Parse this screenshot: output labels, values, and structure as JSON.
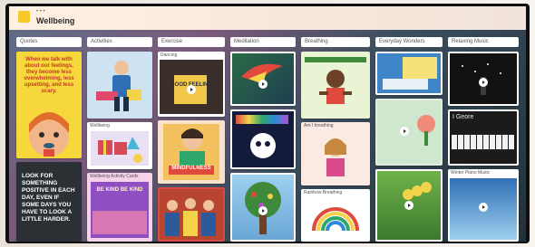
{
  "header": {
    "breadcrumb": "• • •",
    "title": "Wellbeing"
  },
  "columns": [
    {
      "label": "Quotes"
    },
    {
      "label": "Activities"
    },
    {
      "label": "Exercise"
    },
    {
      "label": "Meditation"
    },
    {
      "label": "Breathing"
    },
    {
      "label": "Everyday Wonders"
    },
    {
      "label": "Relaxing Music"
    }
  ],
  "cards": {
    "quote1_text": "When we talk with about our feelings, they become less overwhelming, less upsetting, and less scary.",
    "quote2_text": "LOOK FOR SOMETHING POSITIVE IN EACH DAY, EVEN IF SOME DAYS YOU HAVE TO LOOK A LITTLE HARDER.",
    "exercise1_title": "Dancing",
    "exercise1_art": "GOOD FEELING",
    "exercise3_art": "MINDFULNESS",
    "activity2_title": "Wellbeing",
    "activity3_title": "Wellbeing Activity Cards",
    "activity3_art": "BE KIND BE KIND",
    "meditation2_art": "BE KIND",
    "breathing2_title": "Am I breathing",
    "breathing3_title": "Rainbow Breathing",
    "music2_title": "I Geore",
    "music3_title": "Winter Piano Music"
  },
  "colors": {
    "header_bg": "#f7e7db",
    "logo": "#f7c928",
    "board_bg": "#3c4f5f",
    "card_bg": "#ffffff"
  }
}
